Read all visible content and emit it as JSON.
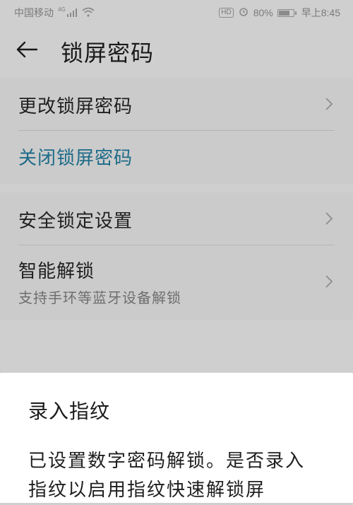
{
  "status_bar": {
    "carrier": "中国移动",
    "signal_label": "4G",
    "hd_badge": "HD",
    "battery_percent": "80%",
    "battery_level": 0.8,
    "time": "早上8:45"
  },
  "header": {
    "title": "锁屏密码"
  },
  "sections": {
    "password": {
      "change_label": "更改锁屏密码",
      "disable_label": "关闭锁屏密码"
    },
    "security": {
      "lock_settings_label": "安全锁定设置",
      "smart_unlock_label": "智能解锁",
      "smart_unlock_sub": "支持手环等蓝牙设备解锁"
    }
  },
  "dialog": {
    "title": "录入指纹",
    "message": "已设置数字密码解锁。是否录入指纹以启用指纹快速解锁屏"
  },
  "colors": {
    "accent": "#1d6b88",
    "scrim": "#cfcfcf",
    "sheet": "#ffffff"
  },
  "icons": {
    "back": "arrow-left-icon",
    "chevron": "chevron-right-icon",
    "wifi": "wifi-icon",
    "alarm": "alarm-icon",
    "battery": "battery-icon"
  }
}
